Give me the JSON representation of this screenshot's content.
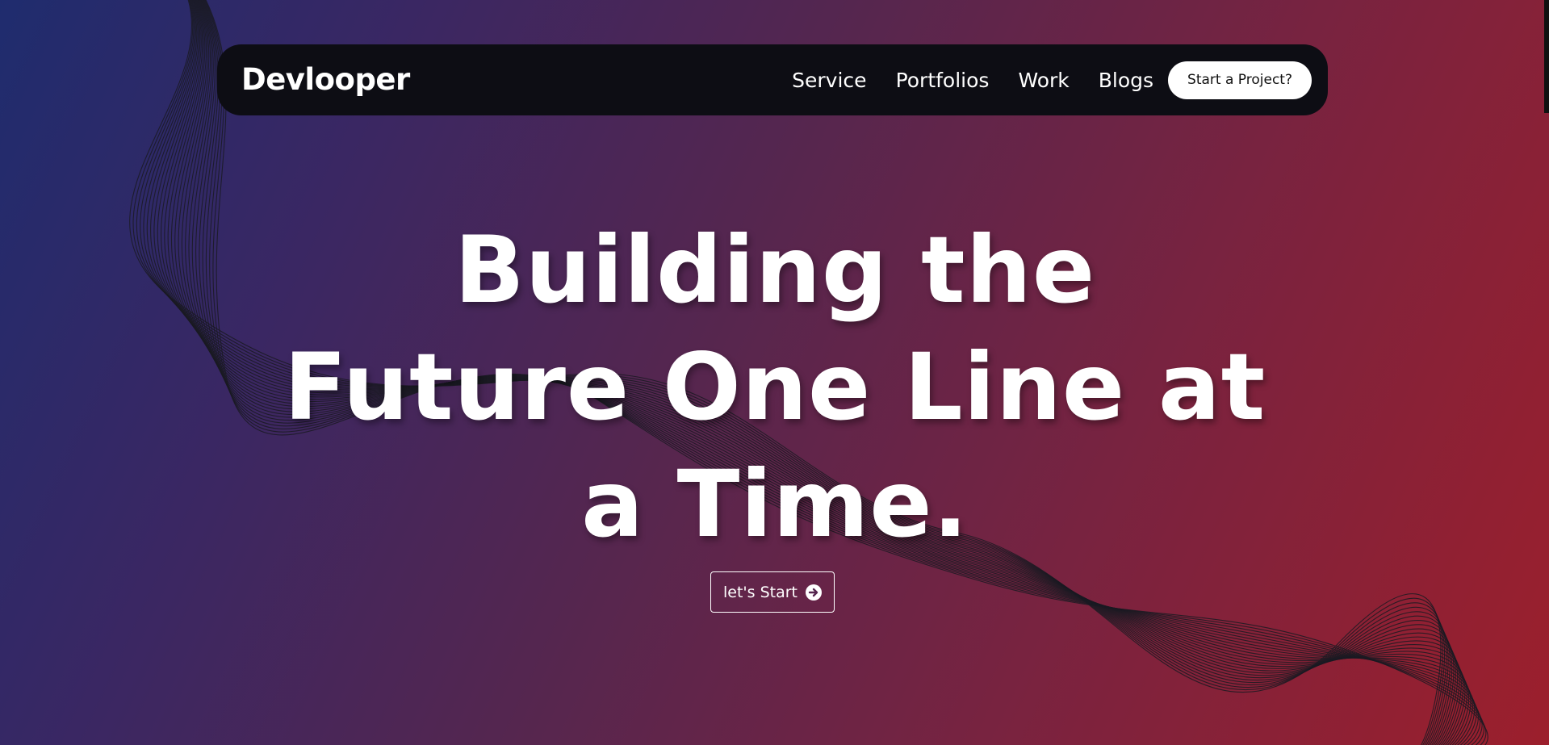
{
  "brand": {
    "logo": "Devlooper"
  },
  "nav": {
    "items": [
      {
        "label": "Service"
      },
      {
        "label": "Portfolios"
      },
      {
        "label": "Work"
      },
      {
        "label": "Blogs"
      }
    ],
    "cta_label": "Start a Project?"
  },
  "hero": {
    "title_lines": [
      "Building the",
      "Future One Line at",
      "a Time."
    ],
    "button_label": "let's Start",
    "button_icon": "arrow-circle-right-icon"
  },
  "colors": {
    "gradient_start": "#1f2c6e",
    "gradient_mid": "#55264f",
    "gradient_end": "#9c1f2c",
    "navbar_bg": "#0d0d14",
    "text": "#ffffff",
    "wave_lines": "#1a1a22"
  }
}
